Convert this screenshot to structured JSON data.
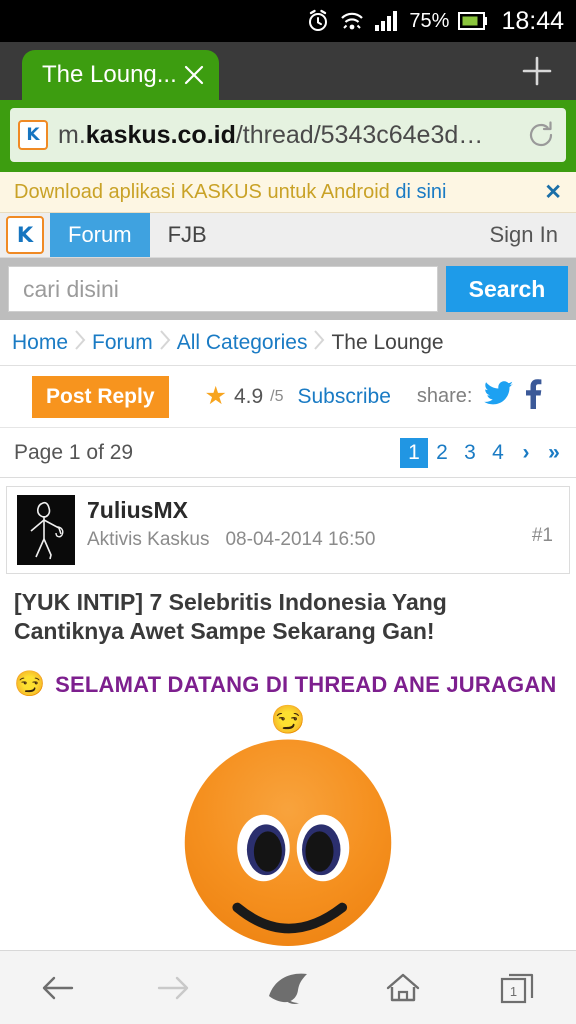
{
  "statusbar": {
    "battery_percent": "75%",
    "clock": "18:44",
    "icons": [
      "alarm-icon",
      "wifi-icon",
      "signal-icon",
      "battery-icon"
    ]
  },
  "browser": {
    "tab": {
      "title": "The Loung...",
      "close_label": "✕"
    },
    "new_tab_label": "+",
    "url": {
      "prefix": "m.",
      "host": "kaskus.co.id",
      "path": "/thread/5343c64e3d…",
      "full": "m.kaskus.co.id/thread/5343c64e3d…"
    },
    "favicon_letter": "K",
    "reload_label": "reload",
    "bottom_nav": [
      "back-icon",
      "forward-icon",
      "dolphin-icon",
      "home-icon",
      "tabs-icon"
    ],
    "tab_count": "1"
  },
  "banner": {
    "text_before": "Download aplikasi KASKUS untuk Android ",
    "link": "di sini",
    "close": "✕"
  },
  "nav": {
    "logo_letter": "K",
    "items": [
      {
        "label": "Forum",
        "active": true
      },
      {
        "label": "FJB",
        "active": false
      }
    ],
    "sign_in": "Sign In"
  },
  "search": {
    "placeholder": "cari disini",
    "value": "",
    "button_label": "Search"
  },
  "breadcrumb": {
    "items": [
      "Home",
      "Forum",
      "All Categories",
      "The Lounge"
    ],
    "separator": "›"
  },
  "actions": {
    "post_reply": "Post Reply",
    "rating_value": "4.9",
    "rating_max": "/5",
    "subscribe": "Subscribe",
    "share_label": "share:",
    "share_targets": [
      "twitter-icon",
      "facebook-icon"
    ]
  },
  "pagination": {
    "label": "Page 1 of 29",
    "current_page": "1",
    "pages": [
      "1",
      "2",
      "3",
      "4"
    ],
    "next": "›",
    "last": "»"
  },
  "post": {
    "username": "7uliusMX",
    "rank": "Aktivis Kaskus",
    "timestamp": "08-04-2014 16:50",
    "post_number": "#1",
    "avatar_alt": "stick-figure-avatar"
  },
  "content": {
    "thread_title": "[YUK INTIP] 7 Selebritis Indonesia Yang Cantiknya Awet Sampe Sekarang Gan!",
    "welcome_emoji": "😏",
    "welcome_text": "SELAMAT DATANG DI THREAD ANE JURAGAN",
    "big_smiley_top_emoji": "😏",
    "big_smiley_alt": "large-orange-smiley"
  },
  "colors": {
    "tab_green": "#3d9d10",
    "kaskus_blue": "#1e9be9",
    "link_blue": "#1a7bc4",
    "orange": "#f7941e",
    "purple": "#7d1f8e",
    "twitter": "#1da1f2",
    "facebook": "#3b5998",
    "banner_bg": "#fdf6e3",
    "smiley_orange": "#f5901f"
  }
}
